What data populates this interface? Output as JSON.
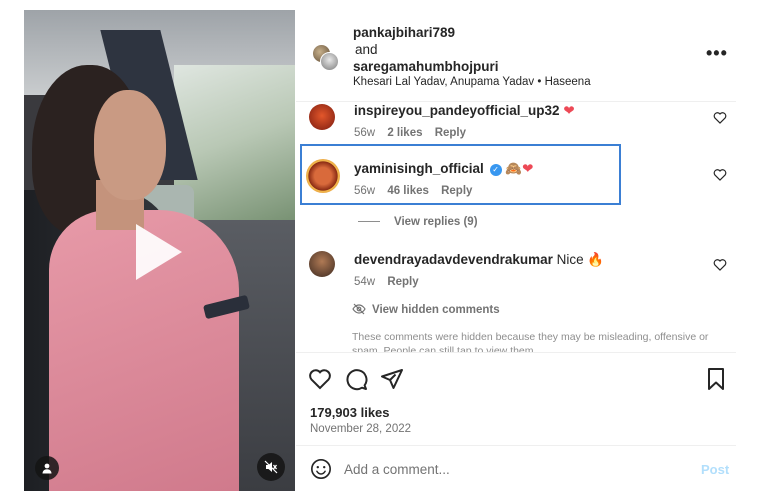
{
  "post": {
    "authors": [
      "pankajbihari789",
      "saregamahumbhojpuri"
    ],
    "and_text": "and",
    "song": "Khesari Lal Yadav, Anupama Yadav • Haseena",
    "more_label": "•••"
  },
  "comments": [
    {
      "user": "inspireyou_pandeyofficial_up32",
      "text": "❤",
      "time": "56w",
      "likes": "2 likes",
      "reply": "Reply",
      "verified": false
    },
    {
      "user": "yaminisingh_official",
      "text": "🙈❤",
      "time": "56w",
      "likes": "46 likes",
      "reply": "Reply",
      "verified": true
    },
    {
      "user": "devendrayadavdevendrakumar",
      "text": "Nice 🔥",
      "time": "54w",
      "likes": "",
      "reply": "Reply",
      "verified": false
    }
  ],
  "view_replies": "View replies (9)",
  "hidden": {
    "link": "View hidden comments",
    "note": "These comments were hidden because they may be misleading, offensive or spam. People can still tap to view them."
  },
  "likes_count": "179,903 likes",
  "date": "November 28, 2022",
  "add_comment": {
    "placeholder": "Add a comment...",
    "post_label": "Post"
  },
  "colors": {
    "accent": "#3897f0",
    "highlight": "#3b7fd4",
    "heart": "#ed4956",
    "post_disabled": "#b2dffc"
  }
}
